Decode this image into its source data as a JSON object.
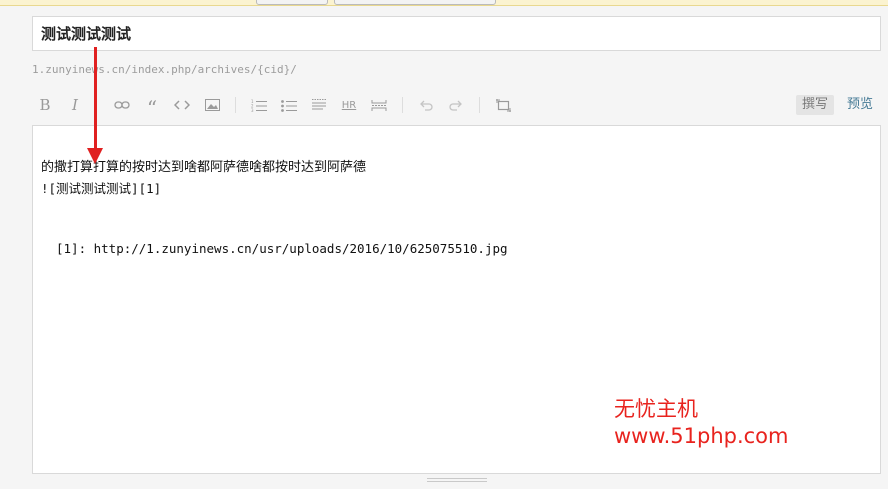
{
  "post": {
    "title": "测试测试测试",
    "permalink": "1.zunyinews.cn/index.php/archives/{cid}/"
  },
  "toolbar": {
    "bold_label": "B",
    "italic_label": "I",
    "quote_label": "“",
    "hr_label": "HR",
    "write_label": "撰写",
    "preview_label": "预览"
  },
  "editor": {
    "lines": [
      "的撒打算打算的按时达到啥都阿萨德啥都按时达到阿萨德",
      "![测试测试测试][1]",
      "[1]: http://1.zunyinews.cn/usr/uploads/2016/10/625075510.jpg"
    ]
  },
  "watermark": {
    "line1": "无忧主机",
    "line2": "www.51php.com"
  },
  "colors": {
    "accent_link": "#467b96",
    "annotation_red": "#e02020",
    "watermark_red": "#e8231e"
  }
}
